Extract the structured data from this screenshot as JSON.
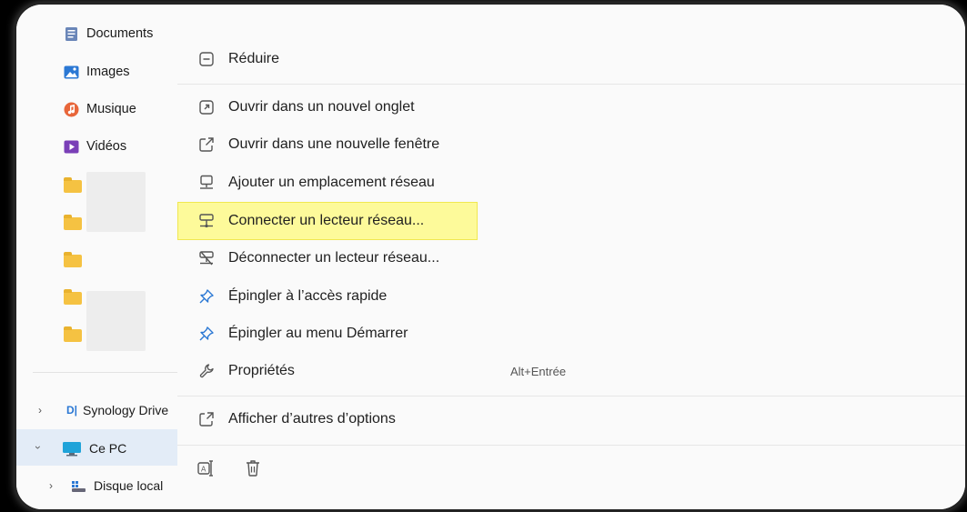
{
  "sidebar": {
    "items": [
      {
        "label": "Documents"
      },
      {
        "label": "Images"
      },
      {
        "label": "Musique"
      },
      {
        "label": "Vidéos"
      }
    ],
    "synology_label": "Synology Drive",
    "this_pc_label": "Ce PC",
    "local_disk_label": "Disque local"
  },
  "menu": {
    "collapse_label": "Réduire",
    "items": [
      {
        "label": "Ouvrir dans un nouvel onglet",
        "icon": "new-tab-icon"
      },
      {
        "label": "Ouvrir dans une nouvelle fenêtre",
        "icon": "new-window-icon"
      },
      {
        "label": "Ajouter un emplacement réseau",
        "icon": "network-location-icon"
      },
      {
        "label": "Connecter un lecteur réseau...",
        "icon": "map-network-drive-icon"
      },
      {
        "label": "Déconnecter un lecteur réseau...",
        "icon": "disconnect-network-drive-icon"
      },
      {
        "label": "Épingler à l’accès rapide",
        "icon": "pin-icon"
      },
      {
        "label": "Épingler au menu Démarrer",
        "icon": "pin-icon"
      },
      {
        "label": "Propriétés",
        "icon": "wrench-icon",
        "shortcut": "Alt+Entrée"
      }
    ],
    "more_options_label": "Afficher d’autres d’options"
  },
  "colors": {
    "highlight": "#fdfa9a",
    "accent_blue": "#2b78d4",
    "folder": "#f5c242"
  }
}
